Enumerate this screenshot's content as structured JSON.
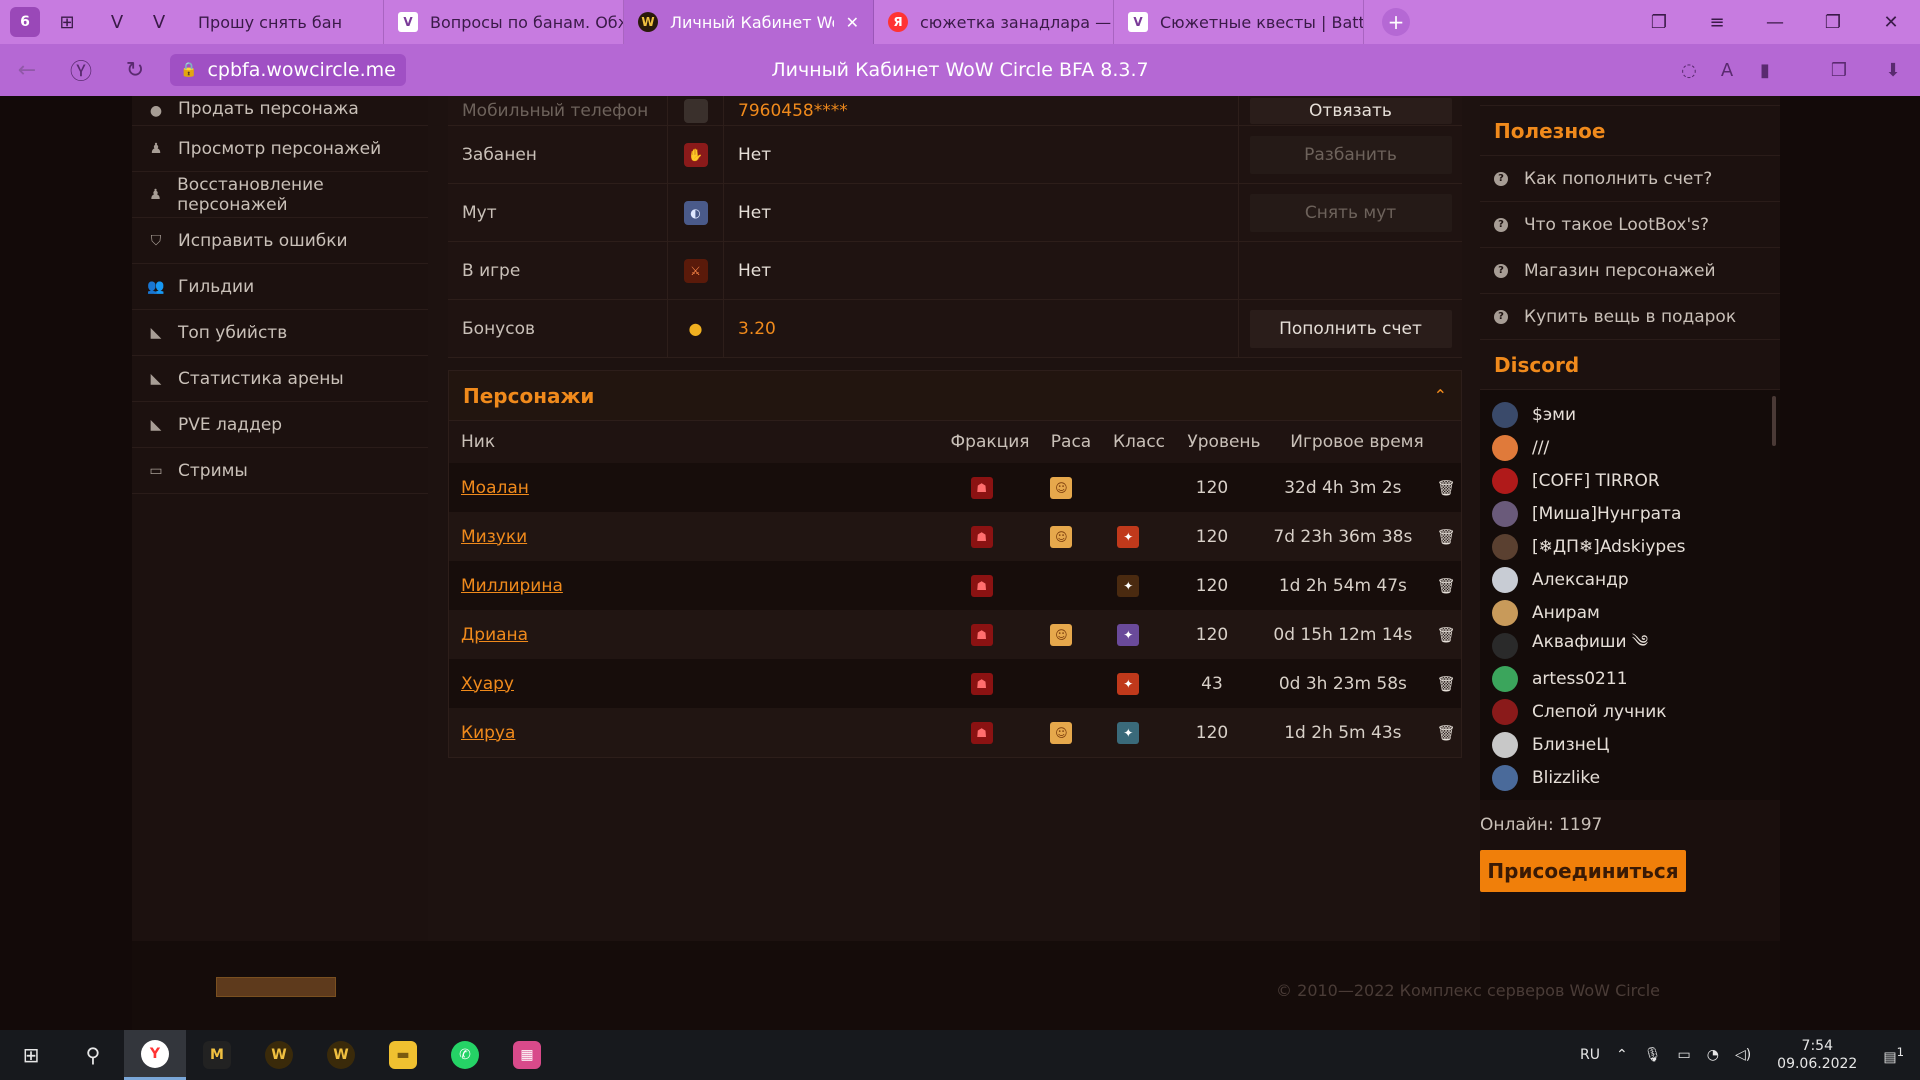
{
  "browser": {
    "tab_count": "6",
    "tabs": [
      {
        "label": "Прошу снять бан",
        "favicon": "V"
      },
      {
        "label": "Вопросы по банам. Обжа",
        "favicon": "V"
      },
      {
        "label": "Личный Кабинет WoW",
        "favicon": "W",
        "close": "✕"
      },
      {
        "label": "сюжетка занадлара — Ян",
        "favicon": "Я"
      },
      {
        "label": "Сюжетные квесты | Battle",
        "favicon": "V"
      }
    ],
    "url": "cpbfa.wowcircle.me",
    "page_title": "Личный Кабинет WoW Circle BFA 8.3.7"
  },
  "sidebar": {
    "items": [
      {
        "label": "Продать персонажа",
        "icon": "user-icon"
      },
      {
        "label": "Просмотр персонажей",
        "icon": "person-icon"
      },
      {
        "label": "Восстановление персонажей",
        "icon": "person-icon"
      },
      {
        "label": "Исправить ошибки",
        "icon": "shield-icon"
      },
      {
        "label": "Гильдии",
        "icon": "users-icon"
      },
      {
        "label": "Топ убийств",
        "icon": "chart-icon"
      },
      {
        "label": "Статистика арены",
        "icon": "chart-icon"
      },
      {
        "label": "PVE ладдер",
        "icon": "chart-icon"
      },
      {
        "label": "Стримы",
        "icon": "stream-icon"
      }
    ]
  },
  "info": {
    "rows": [
      {
        "label": "Мобильный телефон",
        "value": "7960458****",
        "action": "Отвязать",
        "disabled": false,
        "value_orange": true
      },
      {
        "label": "Забанен",
        "value": "Нет",
        "action": "Разбанить",
        "disabled": true,
        "value_orange": false
      },
      {
        "label": "Мут",
        "value": "Нет",
        "action": "Снять мут",
        "disabled": true,
        "value_orange": false
      },
      {
        "label": "В игре",
        "value": "Нет",
        "action": "",
        "disabled": false,
        "value_orange": false
      },
      {
        "label": "Бонусов",
        "value": "3.20",
        "action": "Пополнить счет",
        "disabled": false,
        "value_orange": true
      }
    ]
  },
  "characters": {
    "title": "Персонажи",
    "columns": {
      "nick": "Ник",
      "faction": "Фракция",
      "race": "Раса",
      "class": "Класс",
      "level": "Уровень",
      "playtime": "Игровое время"
    },
    "rows": [
      {
        "nick": "Моалан",
        "race": true,
        "class": false,
        "class_color": "",
        "level": "120",
        "playtime": "32d 4h 3m 2s"
      },
      {
        "nick": "Мизуки",
        "race": true,
        "class": true,
        "class_color": "#c0391b",
        "level": "120",
        "playtime": "7d 23h 36m 38s"
      },
      {
        "nick": "Миллирина",
        "race": false,
        "class": true,
        "class_color": "#4a2a10",
        "level": "120",
        "playtime": "1d 2h 54m 47s"
      },
      {
        "nick": "Дриана",
        "race": true,
        "class": true,
        "class_color": "#6a4a9a",
        "level": "120",
        "playtime": "0d 15h 12m 14s"
      },
      {
        "nick": "Хуару",
        "race": false,
        "class": true,
        "class_color": "#c0391b",
        "level": "43",
        "playtime": "0d 3h 23m 58s"
      },
      {
        "nick": "Кируа",
        "race": true,
        "class": true,
        "class_color": "#3a6a7a",
        "level": "120",
        "playtime": "1d 2h 5m 43s"
      }
    ]
  },
  "useful": {
    "title": "Полезное",
    "links": [
      "Как пополнить счет?",
      "Что такое LootBox's?",
      "Магазин персонажей",
      "Купить вещь в подарок"
    ]
  },
  "discord": {
    "title": "Discord",
    "members": [
      {
        "name": "$эми",
        "color": "#3a4a6a"
      },
      {
        "name": "///",
        "color": "#e07a3a"
      },
      {
        "name": "[COFF] TIRROR",
        "color": "#b01a1a"
      },
      {
        "name": "[Миша]Нунграта",
        "color": "#6a5a7a"
      },
      {
        "name": "[❄ДП❄]Adskiypes",
        "color": "#5a4030"
      },
      {
        "name": "Александр",
        "color": "#c8ccd4"
      },
      {
        "name": "Анирам",
        "color": "#c89a5a"
      },
      {
        "name": "Аквафиши ༄",
        "color": "#2a2a2a"
      },
      {
        "name": "artess0211",
        "color": "#3ba55c"
      },
      {
        "name": "Слепой лучник",
        "color": "#8a1a1a"
      },
      {
        "name": "БлизнеЦ",
        "color": "#c8c8c8"
      },
      {
        "name": "Blizzlike",
        "color": "#4a6a9a"
      }
    ],
    "online": "Онлайн: 1197",
    "join": "Присоединиться"
  },
  "footer": {
    "copyright": "© 2010—2022 Комплекс серверов WoW Circle"
  },
  "taskbar": {
    "lang": "RU",
    "time": "7:54",
    "date": "09.06.2022",
    "notif": "1"
  }
}
